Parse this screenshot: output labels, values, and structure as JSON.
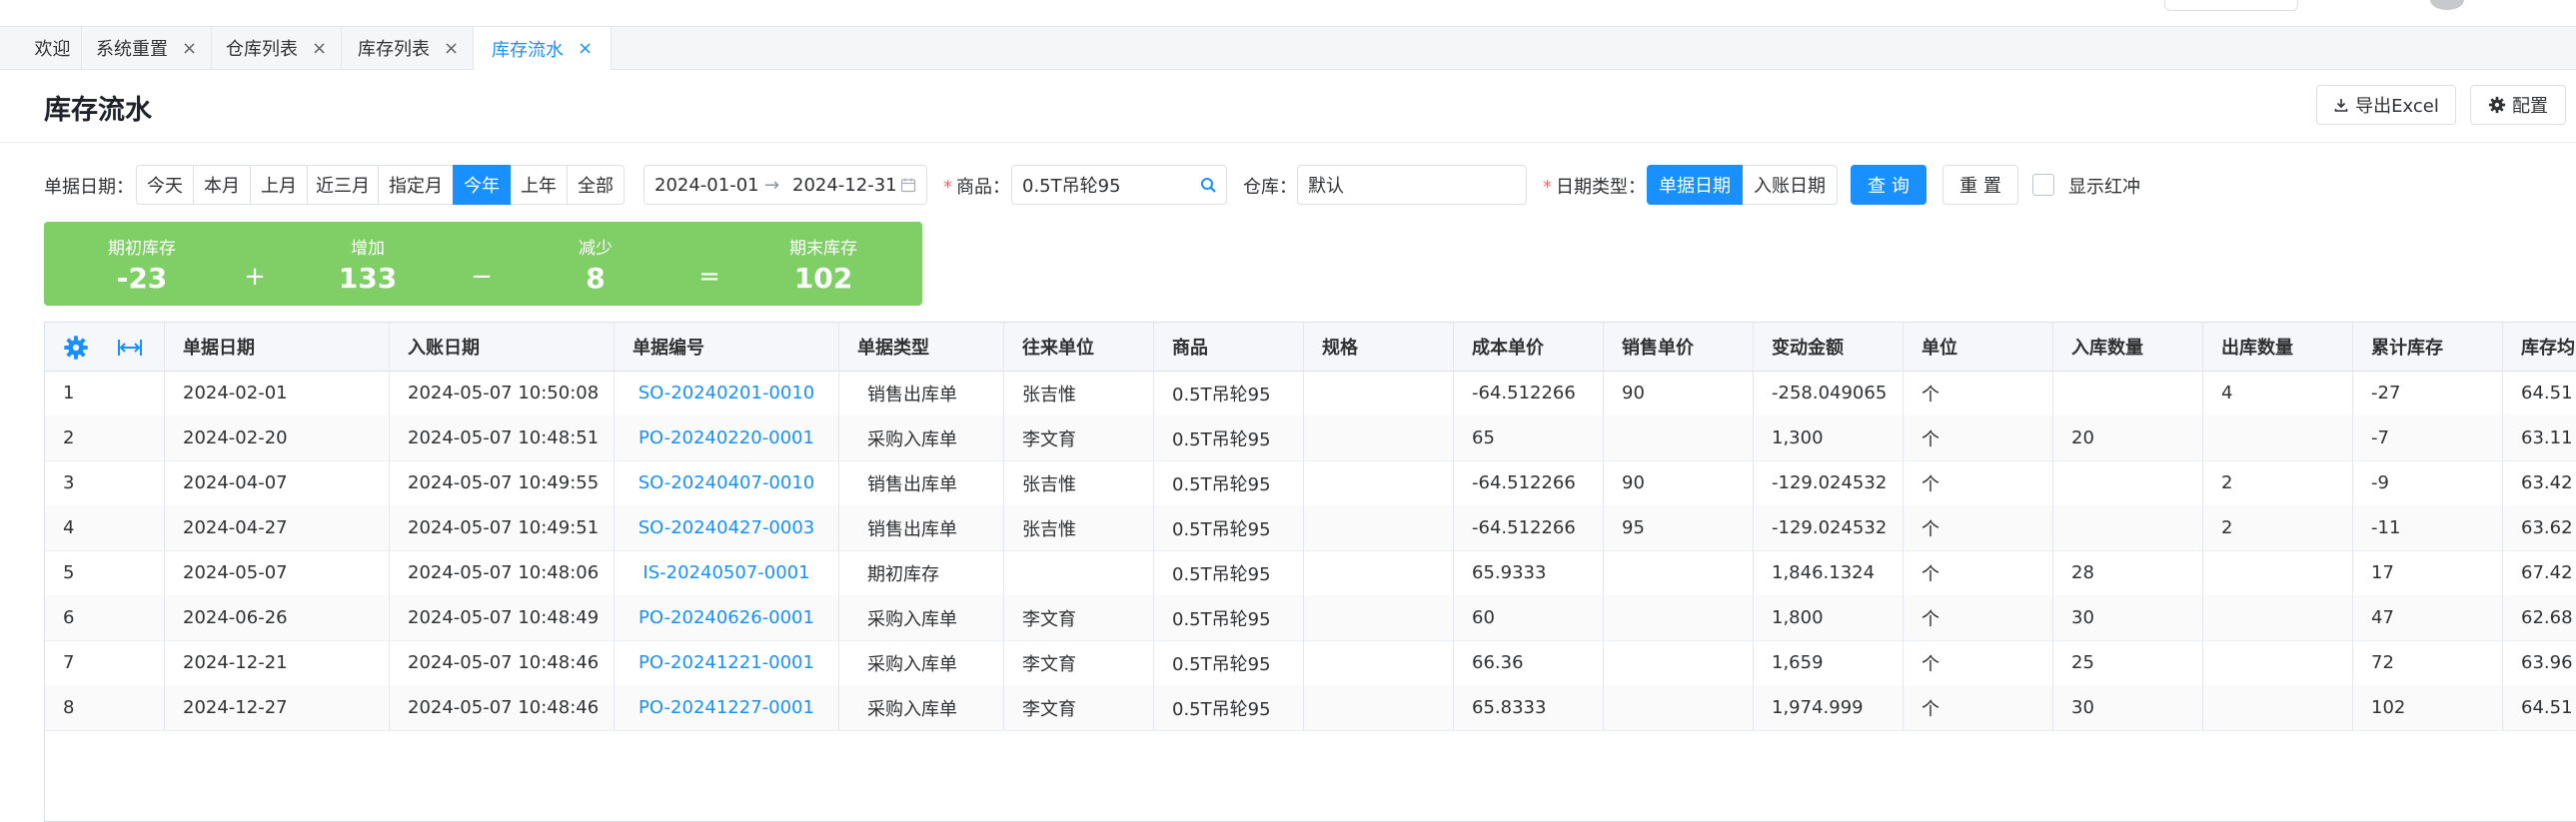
{
  "tabs": [
    {
      "label": "欢迎",
      "closable": false
    },
    {
      "label": "系统重置",
      "closable": true
    },
    {
      "label": "仓库列表",
      "closable": true
    },
    {
      "label": "库存列表",
      "closable": true
    },
    {
      "label": "库存流水",
      "closable": true,
      "active": true
    }
  ],
  "tab_close_glyph": "×",
  "page": {
    "title": "库存流水",
    "export_label": "导出Excel",
    "config_label": "配置"
  },
  "filters": {
    "doc_date_label": "单据日期：",
    "quick_ranges": [
      "今天",
      "本月",
      "上月",
      "近三月",
      "指定月",
      "今年",
      "上年",
      "全部"
    ],
    "quick_range_active": "今年",
    "date_start": "2024-01-01",
    "date_sep": "→",
    "date_end": "2024-12-31",
    "product_label": "商品：",
    "product_value": "0.5T吊轮95",
    "warehouse_label": "仓库：",
    "warehouse_value": "默认",
    "date_type_label": "日期类型：",
    "date_types": [
      "单据日期",
      "入账日期"
    ],
    "date_type_active": "单据日期",
    "query_label": "查 询",
    "reset_label": "重 置",
    "show_red_label": "显示红冲",
    "show_red_checked": false
  },
  "summary": {
    "opening_label": "期初库存",
    "opening_value": "-23",
    "op_plus": "+",
    "increase_label": "增加",
    "increase_value": "133",
    "op_minus": "−",
    "decrease_label": "减少",
    "decrease_value": "8",
    "op_equals": "=",
    "closing_label": "期末库存",
    "closing_value": "102"
  },
  "table": {
    "columns": [
      "单据日期",
      "入账日期",
      "单据编号",
      "单据类型",
      "往来单位",
      "商品",
      "规格",
      "成本单价",
      "销售单价",
      "变动金额",
      "单位",
      "入库数量",
      "出库数量",
      "累计库存",
      "库存均"
    ],
    "rows": [
      {
        "idx": "1",
        "doc_date": "2024-02-01",
        "post_date": "2024-05-07 10:50:08",
        "doc_no": "SO-20240201-0010",
        "doc_type": "销售出库单",
        "partner": "张吉惟",
        "product": "0.5T吊轮95",
        "spec": "",
        "cost": "-64.512266",
        "price": "90",
        "amount": "-258.049065",
        "unit": "个",
        "in_qty": "",
        "out_qty": "4",
        "balance": "-27",
        "avg": "64.51"
      },
      {
        "idx": "2",
        "doc_date": "2024-02-20",
        "post_date": "2024-05-07 10:48:51",
        "doc_no": "PO-20240220-0001",
        "doc_type": "采购入库单",
        "partner": "李文育",
        "product": "0.5T吊轮95",
        "spec": "",
        "cost": "65",
        "price": "",
        "amount": "1,300",
        "unit": "个",
        "in_qty": "20",
        "out_qty": "",
        "balance": "-7",
        "avg": "63.11"
      },
      {
        "idx": "3",
        "doc_date": "2024-04-07",
        "post_date": "2024-05-07 10:49:55",
        "doc_no": "SO-20240407-0010",
        "doc_type": "销售出库单",
        "partner": "张吉惟",
        "product": "0.5T吊轮95",
        "spec": "",
        "cost": "-64.512266",
        "price": "90",
        "amount": "-129.024532",
        "unit": "个",
        "in_qty": "",
        "out_qty": "2",
        "balance": "-9",
        "avg": "63.42"
      },
      {
        "idx": "4",
        "doc_date": "2024-04-27",
        "post_date": "2024-05-07 10:49:51",
        "doc_no": "SO-20240427-0003",
        "doc_type": "销售出库单",
        "partner": "张吉惟",
        "product": "0.5T吊轮95",
        "spec": "",
        "cost": "-64.512266",
        "price": "95",
        "amount": "-129.024532",
        "unit": "个",
        "in_qty": "",
        "out_qty": "2",
        "balance": "-11",
        "avg": "63.62"
      },
      {
        "idx": "5",
        "doc_date": "2024-05-07",
        "post_date": "2024-05-07 10:48:06",
        "doc_no": "IS-20240507-0001",
        "doc_type": "期初库存",
        "partner": "",
        "product": "0.5T吊轮95",
        "spec": "",
        "cost": "65.9333",
        "price": "",
        "amount": "1,846.1324",
        "unit": "个",
        "in_qty": "28",
        "out_qty": "",
        "balance": "17",
        "avg": "67.42"
      },
      {
        "idx": "6",
        "doc_date": "2024-06-26",
        "post_date": "2024-05-07 10:48:49",
        "doc_no": "PO-20240626-0001",
        "doc_type": "采购入库单",
        "partner": "李文育",
        "product": "0.5T吊轮95",
        "spec": "",
        "cost": "60",
        "price": "",
        "amount": "1,800",
        "unit": "个",
        "in_qty": "30",
        "out_qty": "",
        "balance": "47",
        "avg": "62.68"
      },
      {
        "idx": "7",
        "doc_date": "2024-12-21",
        "post_date": "2024-05-07 10:48:46",
        "doc_no": "PO-20241221-0001",
        "doc_type": "采购入库单",
        "partner": "李文育",
        "product": "0.5T吊轮95",
        "spec": "",
        "cost": "66.36",
        "price": "",
        "amount": "1,659",
        "unit": "个",
        "in_qty": "25",
        "out_qty": "",
        "balance": "72",
        "avg": "63.96"
      },
      {
        "idx": "8",
        "doc_date": "2024-12-27",
        "post_date": "2024-05-07 10:48:46",
        "doc_no": "PO-20241227-0001",
        "doc_type": "采购入库单",
        "partner": "李文育",
        "product": "0.5T吊轮95",
        "spec": "",
        "cost": "65.8333",
        "price": "",
        "amount": "1,974.999",
        "unit": "个",
        "in_qty": "30",
        "out_qty": "",
        "balance": "102",
        "avg": "64.51"
      }
    ]
  },
  "colors": {
    "primary": "#1890ff",
    "summary_bg": "#7fcf66",
    "link": "#1890ff"
  }
}
